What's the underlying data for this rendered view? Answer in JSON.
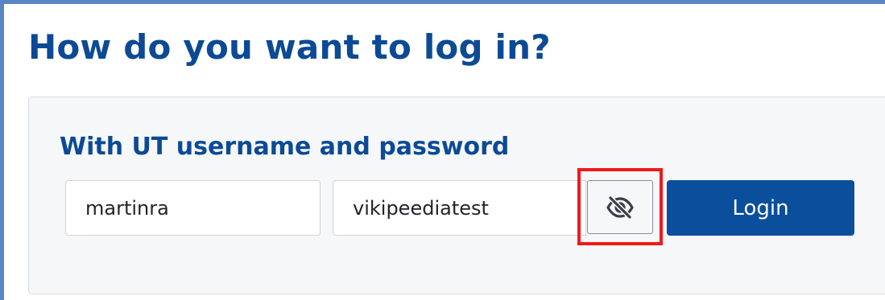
{
  "page": {
    "heading": "How do you want to log in?"
  },
  "login_panel": {
    "title": "With UT username and password",
    "username": {
      "value": "martinra"
    },
    "password": {
      "value": "vikipeediatest",
      "visibility_icon": "eye-slash-icon"
    },
    "login_label": "Login"
  },
  "colors": {
    "heading": "#0c4a95",
    "login_button": "#0b4e9c",
    "highlight_box": "#ef1a1a",
    "frame_border": "#5b84c4",
    "panel_background": "#f6f7f9"
  }
}
